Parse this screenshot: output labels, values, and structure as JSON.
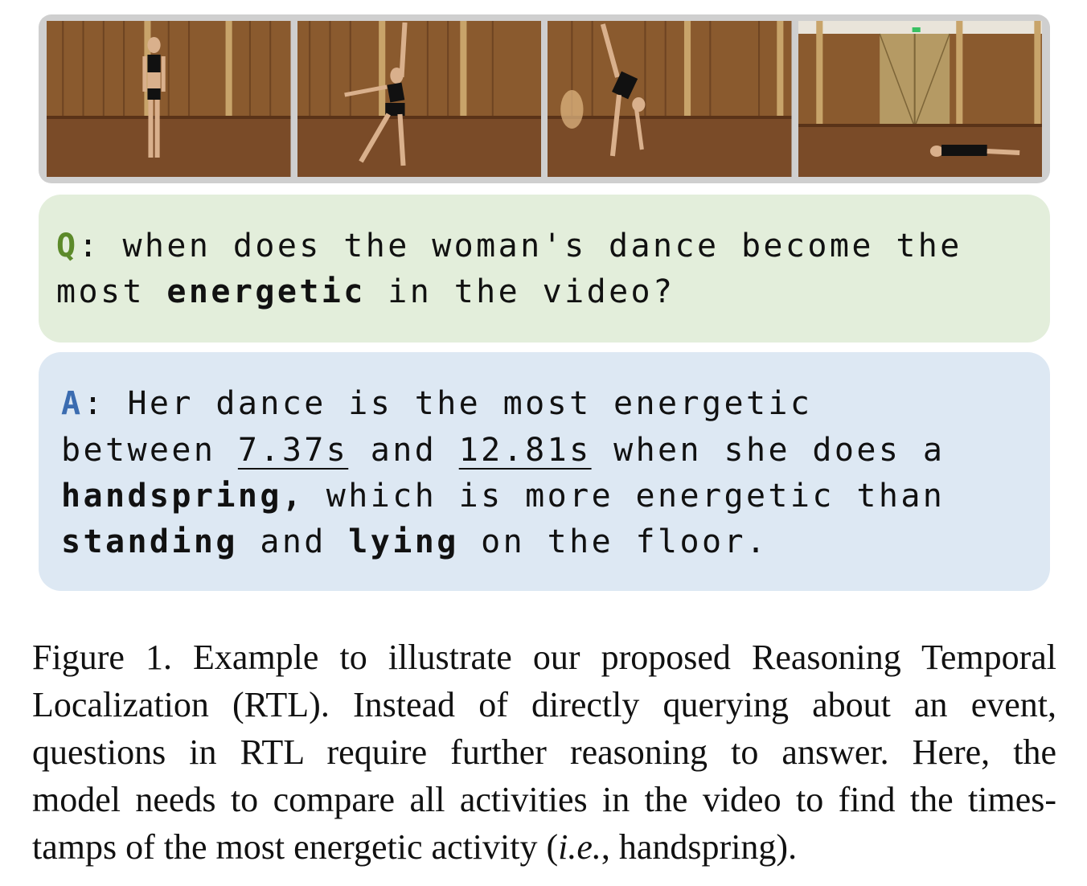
{
  "frames": [
    {
      "alt": "woman standing"
    },
    {
      "alt": "woman dancing"
    },
    {
      "alt": "woman doing a handspring"
    },
    {
      "alt": "woman lying on the floor"
    }
  ],
  "question": {
    "tag": "Q",
    "line1": ": when does the woman's dance become the",
    "line2_pre": "most ",
    "line2_bold": "energetic",
    "line2_post": " in the video?"
  },
  "answer": {
    "tag": "A",
    "line1": ": Her dance is the most energetic",
    "line2_a": "between ",
    "start_time": "7.37s",
    "line2_b": " and ",
    "end_time": "12.81s",
    "line2_c": " when she does a",
    "line3_bold": "handspring,",
    "line3_post": " which is more energetic than",
    "line4_bold1": "standing",
    "line4_mid": " and ",
    "line4_bold2": "lying",
    "line4_post": " on the floor."
  },
  "caption": {
    "line1": "Figure 1. Example to illustrate our proposed Reasoning Temporal",
    "line2": "Localization (RTL). Instead of directly querying about an event,",
    "line3": "questions in RTL require further reasoning to answer.  Here, the",
    "line4": "model needs to compare all activities in the video to find the times-",
    "line5_pre": "tamps of the most energetic activity (",
    "line5_it": "i.e.",
    "line5_post": ", handspring)."
  },
  "colors": {
    "q_panel": "#e3eedb",
    "a_panel": "#dde8f3",
    "q_tag": "#5c8a2a",
    "a_tag": "#3b6cb0"
  }
}
